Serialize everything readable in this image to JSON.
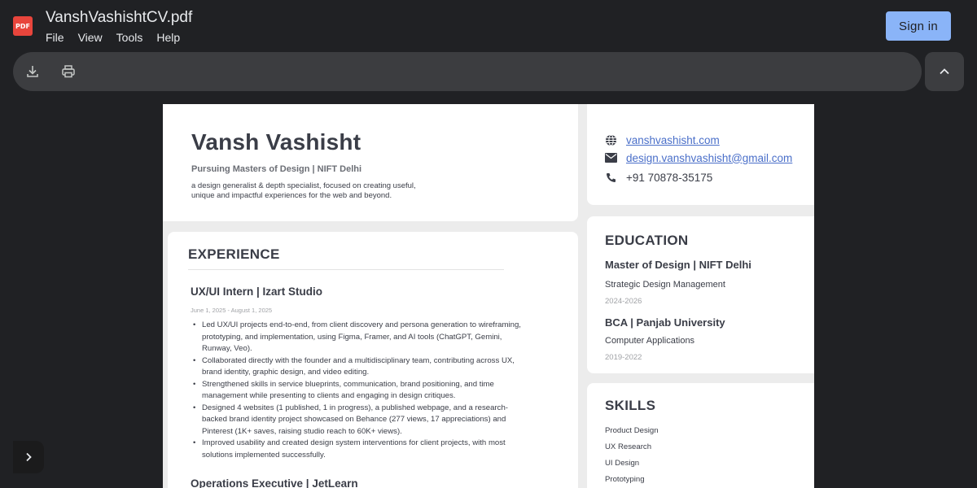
{
  "app": {
    "title": "VanshVashishtCV.pdf",
    "logo_text": "PDF",
    "menu": [
      "File",
      "View",
      "Tools",
      "Help"
    ],
    "sign_in_label": "Sign in"
  },
  "toolbar": {
    "icons": [
      "download-icon",
      "print-icon",
      "chevron-up-icon"
    ]
  },
  "sidebar": {
    "toggle_icon": "chevron-right-icon"
  },
  "colors": {
    "background": "#202124",
    "accent": "#8ab4f8",
    "toolbar": "#3c3d40",
    "link": "#4a6fc9"
  },
  "resume": {
    "name": "Vansh Vashisht",
    "subtitle": "Pursuing Masters of Design | NIFT Delhi",
    "tagline_lines": [
      "a design generalist & depth specialist, focused on creating useful,",
      "unique and impactful experiences for the web and beyond."
    ],
    "contact": {
      "website": "vanshvashisht.com",
      "email": "design.vanshvashisht@gmail.com",
      "phone": "+91 70878-35175"
    },
    "experience": {
      "heading": "EXPERIENCE",
      "jobs": [
        {
          "title": "UX/UI Intern | Izart Studio",
          "dates": "June 1, 2025 - August 1, 2025",
          "bullet_lines": [
            [
              "Led UX/UI projects end-to-end, from client discovery and persona generation to wireframing,",
              "prototyping, and implementation, using Figma, Framer, and AI tools (ChatGPT, Gemini,",
              "Runway, Veo)."
            ],
            [
              "Collaborated directly with the founder and a multidisciplinary team, contributing across UX,",
              "brand identity, graphic design, and video editing."
            ],
            [
              "Strengthened skills in service blueprints, communication, brand positioning, and time",
              "management while presenting to clients and engaging in design critiques."
            ],
            [
              "Designed 4 websites (1 published, 1 in progress), a published webpage, and a research-",
              "backed brand identity project showcased on Behance (277 views, 17 appreciations) and",
              "Pinterest (1K+ saves, raising studio reach to 60K+ views)."
            ],
            [
              "Improved usability and created design system interventions for client projects, with most",
              "solutions implemented successfully."
            ]
          ]
        },
        {
          "title": "Operations Executive | JetLearn"
        }
      ]
    },
    "education": {
      "heading": "EDUCATION",
      "items": [
        {
          "degree": "Master of Design | NIFT Delhi",
          "specialization": "Strategic Design Management",
          "years": "2024-2026"
        },
        {
          "degree": "BCA | Panjab University",
          "specialization": "Computer Applications",
          "years": "2019-2022"
        }
      ]
    },
    "skills": {
      "heading": "SKILLS",
      "items": [
        "Product Design",
        "UX Research",
        "UI Design",
        "Prototyping"
      ]
    }
  }
}
